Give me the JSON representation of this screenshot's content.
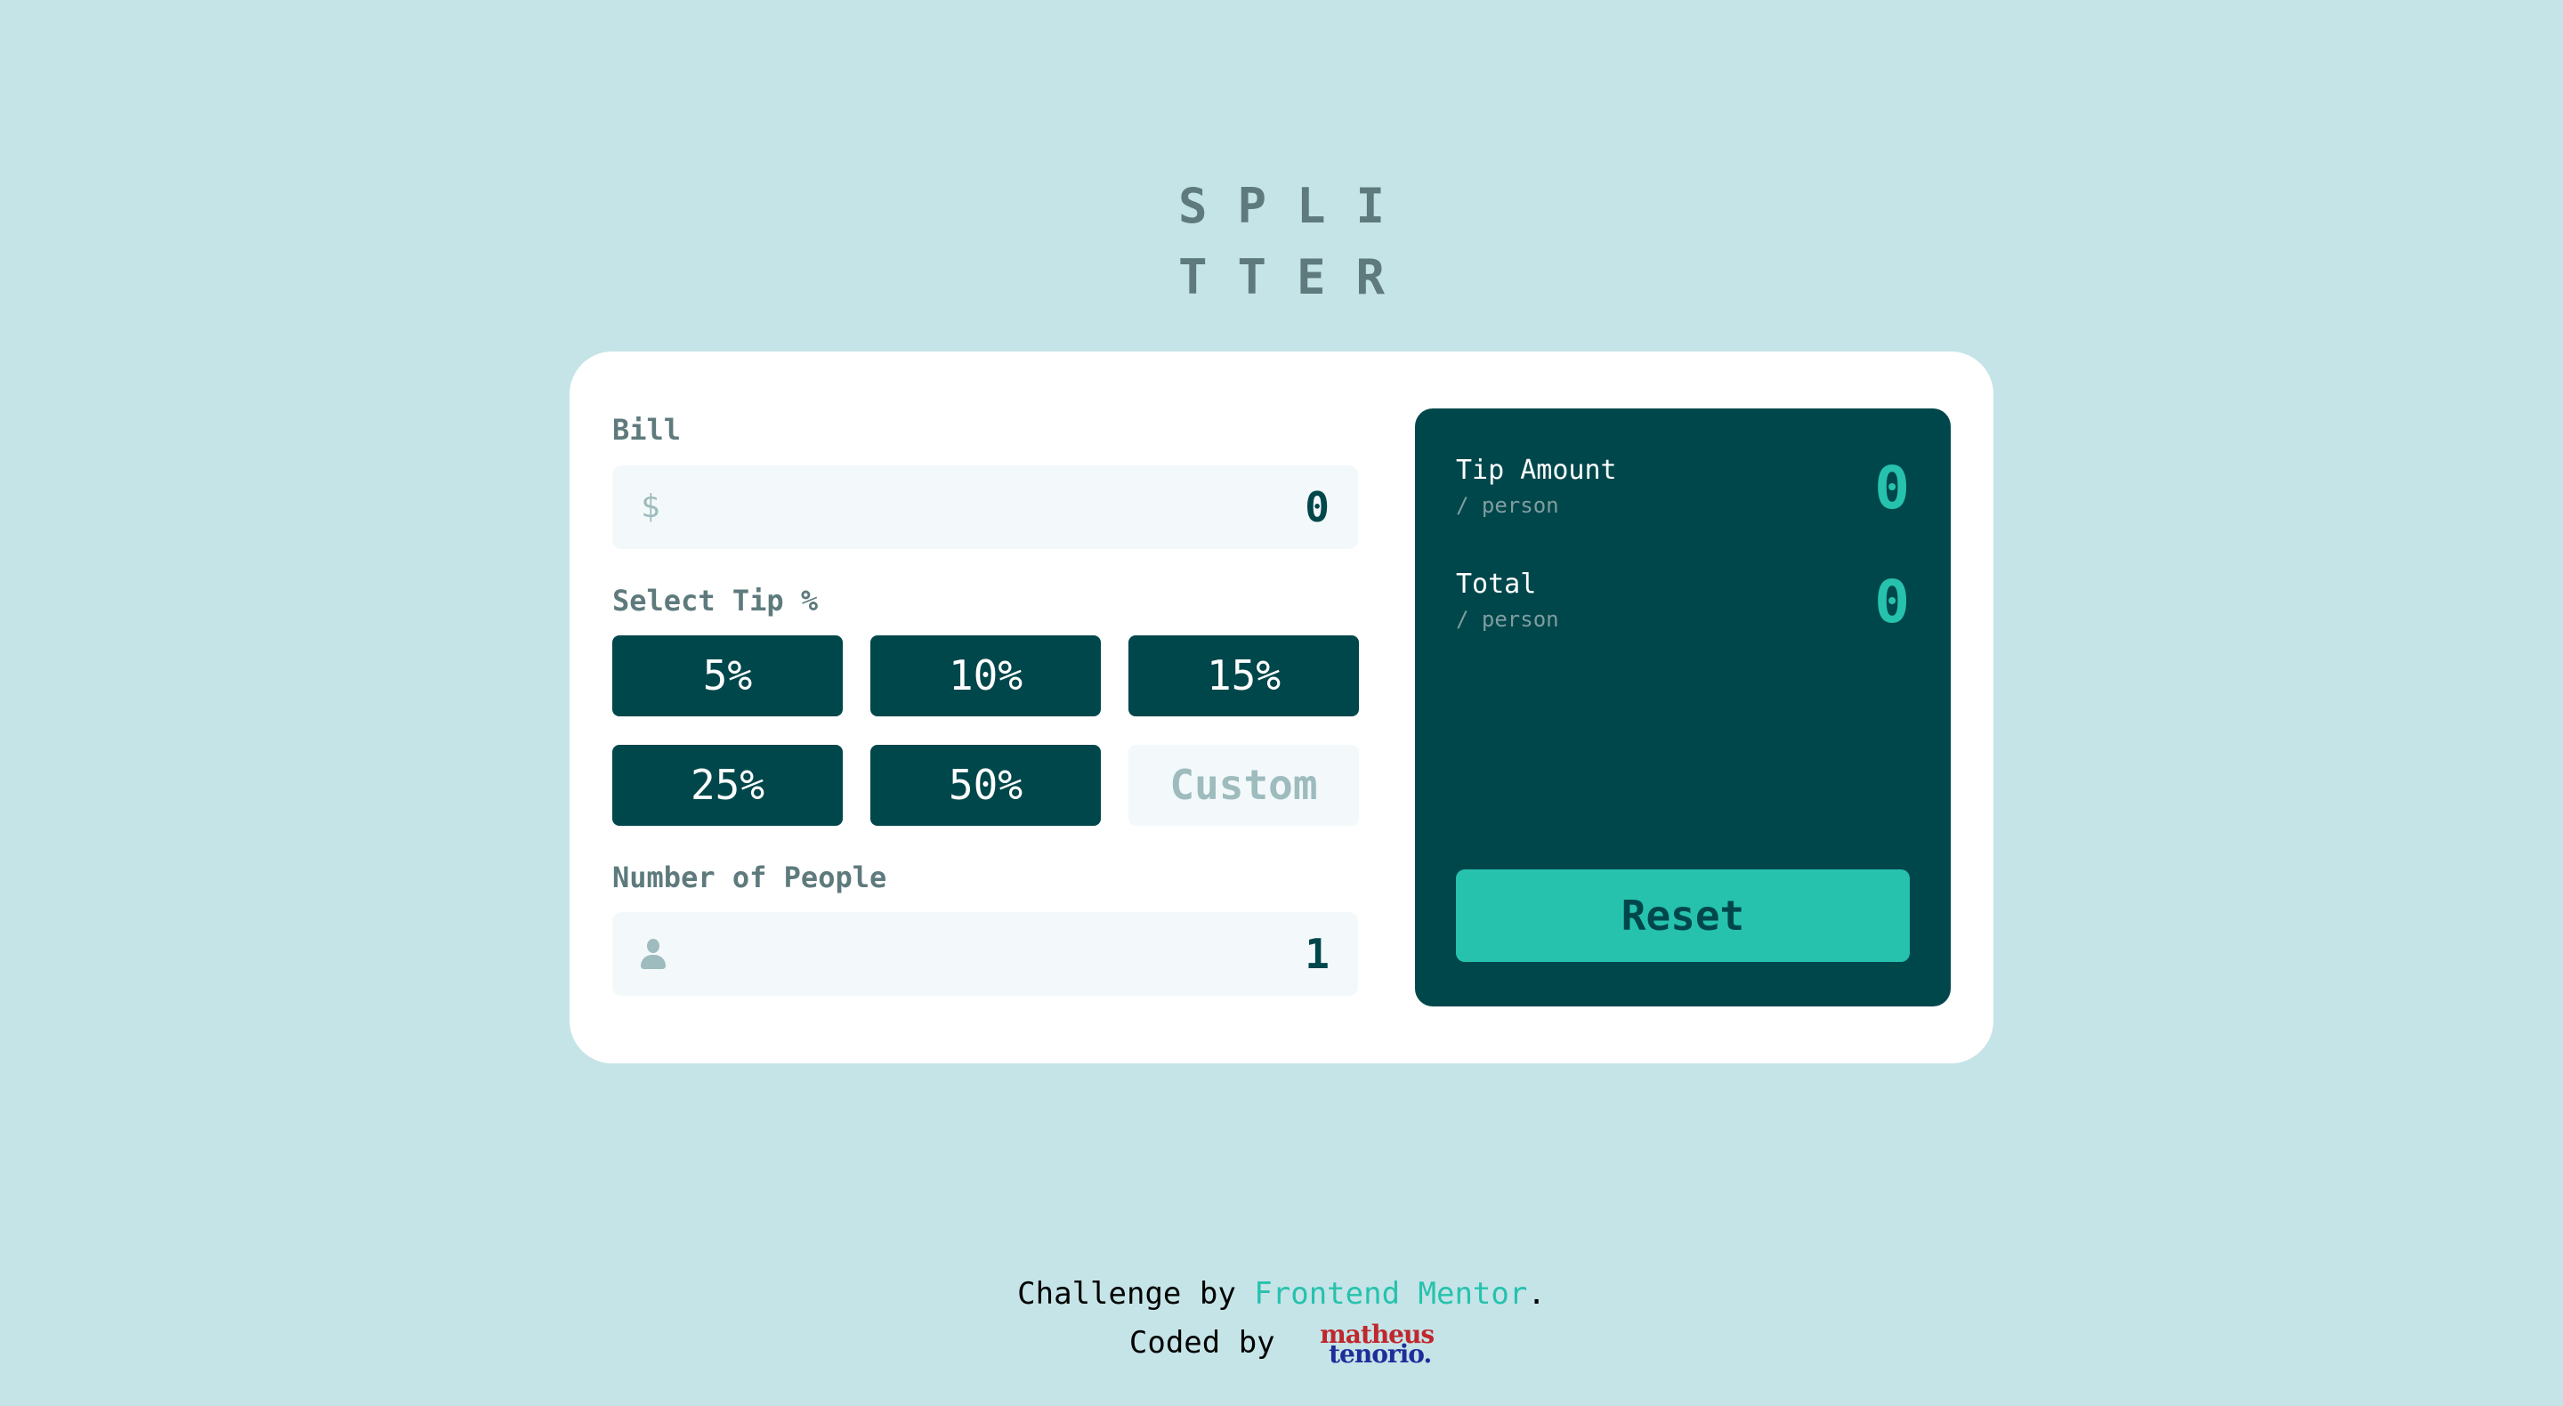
{
  "logo": {
    "line1": "SPLI",
    "line2": "TTER"
  },
  "bill": {
    "label": "Bill",
    "currency_icon": "$",
    "value": "0"
  },
  "tip": {
    "label": "Select Tip %",
    "options": [
      "5%",
      "10%",
      "15%",
      "25%",
      "50%"
    ],
    "custom_placeholder": "Custom"
  },
  "people": {
    "label": "Number of People",
    "value": "1"
  },
  "results": {
    "tip_amount": {
      "title": "Tip Amount",
      "sub": "/ person",
      "value": "0"
    },
    "total": {
      "title": "Total",
      "sub": "/ person",
      "value": "0"
    },
    "reset_label": "Reset"
  },
  "footer": {
    "challenge_prefix": "Challenge by ",
    "challenge_link": "Frontend Mentor",
    "challenge_suffix": ".",
    "coded_by": "Coded by",
    "signature_line1": "matheus",
    "signature_line2": "tenorio."
  },
  "colors": {
    "background": "#c5e4e7",
    "dark_cyan": "#00474b",
    "accent": "#26c2ae",
    "label_grey": "#5e7a7d",
    "input_bg": "#f3f9fa"
  }
}
